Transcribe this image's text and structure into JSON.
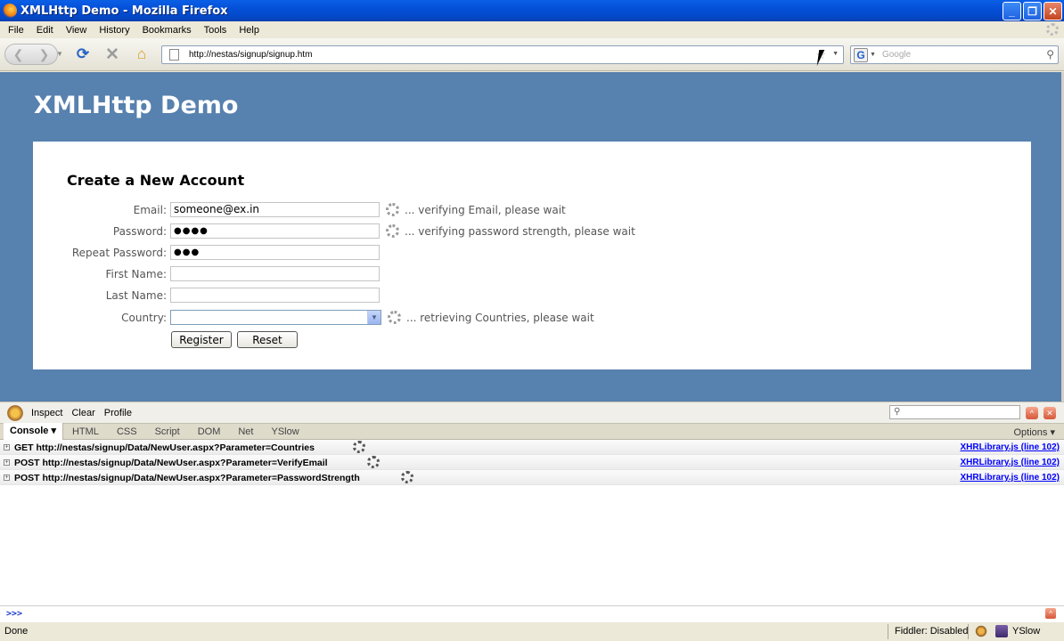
{
  "window": {
    "title": "XMLHttp Demo - Mozilla Firefox"
  },
  "menu": [
    "File",
    "Edit",
    "View",
    "History",
    "Bookmarks",
    "Tools",
    "Help"
  ],
  "nav": {
    "url": "http://nestas/signup/signup.htm",
    "search_placeholder": "Google"
  },
  "page": {
    "heading": "XMLHttp Demo",
    "form_title": "Create a New Account",
    "fields": {
      "email": {
        "label": "Email:",
        "value": "someone@ex.in",
        "status": "... verifying Email, please wait"
      },
      "password": {
        "label": "Password:",
        "value": "●●●●",
        "status": "... verifying password strength, please wait"
      },
      "repeat_password": {
        "label": "Repeat Password:",
        "value": "●●●"
      },
      "first_name": {
        "label": "First Name:",
        "value": ""
      },
      "last_name": {
        "label": "Last Name:",
        "value": ""
      },
      "country": {
        "label": "Country:",
        "value": "",
        "status": "... retrieving Countries, please wait"
      }
    },
    "buttons": {
      "register": "Register",
      "reset": "Reset"
    }
  },
  "firebug": {
    "commands": [
      "Inspect",
      "Clear",
      "Profile"
    ],
    "tabs": [
      "Console ▾",
      "HTML",
      "CSS",
      "Script",
      "DOM",
      "Net",
      "YSlow"
    ],
    "options": "Options ▾",
    "logs": [
      {
        "text": "GET http://nestas/signup/Data/NewUser.aspx?Parameter=Countries",
        "source": "XHRLibrary.js (line 102)"
      },
      {
        "text": "POST http://nestas/signup/Data/NewUser.aspx?Parameter=VerifyEmail",
        "source": "XHRLibrary.js (line 102)"
      },
      {
        "text": "POST http://nestas/signup/Data/NewUser.aspx?Parameter=PasswordStrength",
        "source": "XHRLibrary.js (line 102)"
      }
    ],
    "prompt": ">>>"
  },
  "statusbar": {
    "left": "Done",
    "fiddler": "Fiddler: Disabled",
    "yslow": "YSlow"
  }
}
